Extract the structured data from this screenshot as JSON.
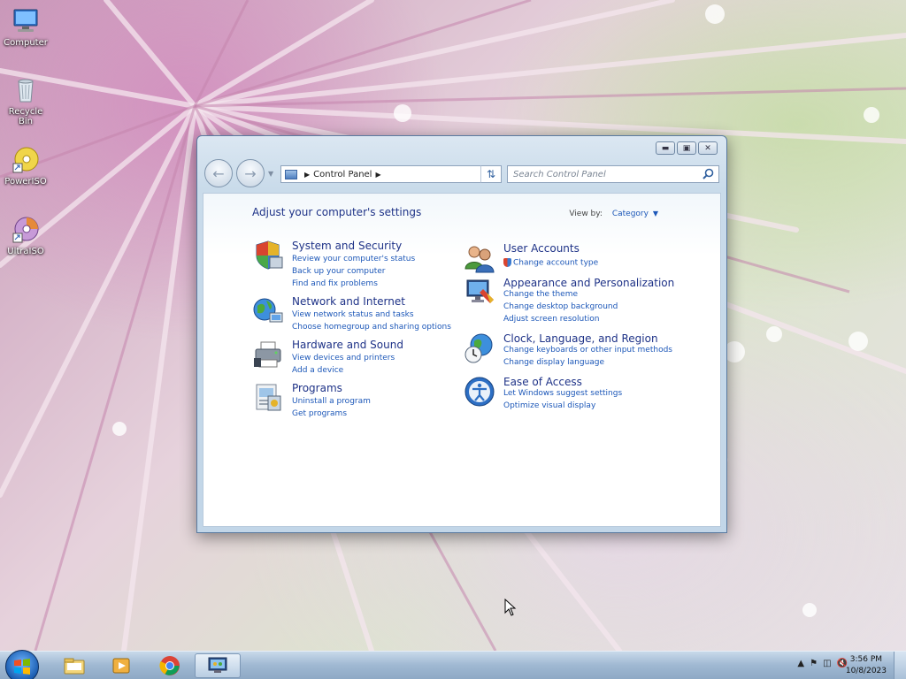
{
  "desktop": {
    "icons": [
      {
        "label": "Computer",
        "icon": "computer-icon"
      },
      {
        "label": "Recycle Bin",
        "icon": "recycle-bin-icon"
      },
      {
        "label": "PowerISO",
        "icon": "poweriso-icon"
      },
      {
        "label": "UltraISO",
        "icon": "ultraiso-icon"
      }
    ]
  },
  "window": {
    "address": {
      "segment": "Control Panel"
    },
    "search": {
      "placeholder": "Search Control Panel"
    },
    "heading": "Adjust your computer's settings",
    "view_by": {
      "label": "View by:",
      "value": "Category"
    },
    "categories_left": [
      {
        "title": "System and Security",
        "icon": "shield-icon",
        "links": [
          "Review your computer's status",
          "Back up your computer",
          "Find and fix problems"
        ]
      },
      {
        "title": "Network and Internet",
        "icon": "globe-network-icon",
        "links": [
          "View network status and tasks",
          "Choose homegroup and sharing options"
        ]
      },
      {
        "title": "Hardware and Sound",
        "icon": "printer-icon",
        "links": [
          "View devices and printers",
          "Add a device"
        ]
      },
      {
        "title": "Programs",
        "icon": "programs-icon",
        "links": [
          "Uninstall a program",
          "Get programs"
        ]
      }
    ],
    "categories_right": [
      {
        "title": "User Accounts",
        "icon": "users-icon",
        "links": [
          "Change account type"
        ]
      },
      {
        "title": "Appearance and Personalization",
        "icon": "monitor-paint-icon",
        "links": [
          "Change the theme",
          "Change desktop background",
          "Adjust screen resolution"
        ]
      },
      {
        "title": "Clock, Language, and Region",
        "icon": "clock-globe-icon",
        "links": [
          "Change keyboards or other input methods",
          "Change display language"
        ]
      },
      {
        "title": "Ease of Access",
        "icon": "ease-of-access-icon",
        "links": [
          "Let Windows suggest settings",
          "Optimize visual display"
        ]
      }
    ]
  },
  "taskbar": {
    "clock_time": "3:56 PM",
    "clock_date": "10/8/2023",
    "apps": [
      "file-explorer-icon",
      "media-player-icon",
      "chrome-icon",
      "control-panel-icon"
    ]
  }
}
